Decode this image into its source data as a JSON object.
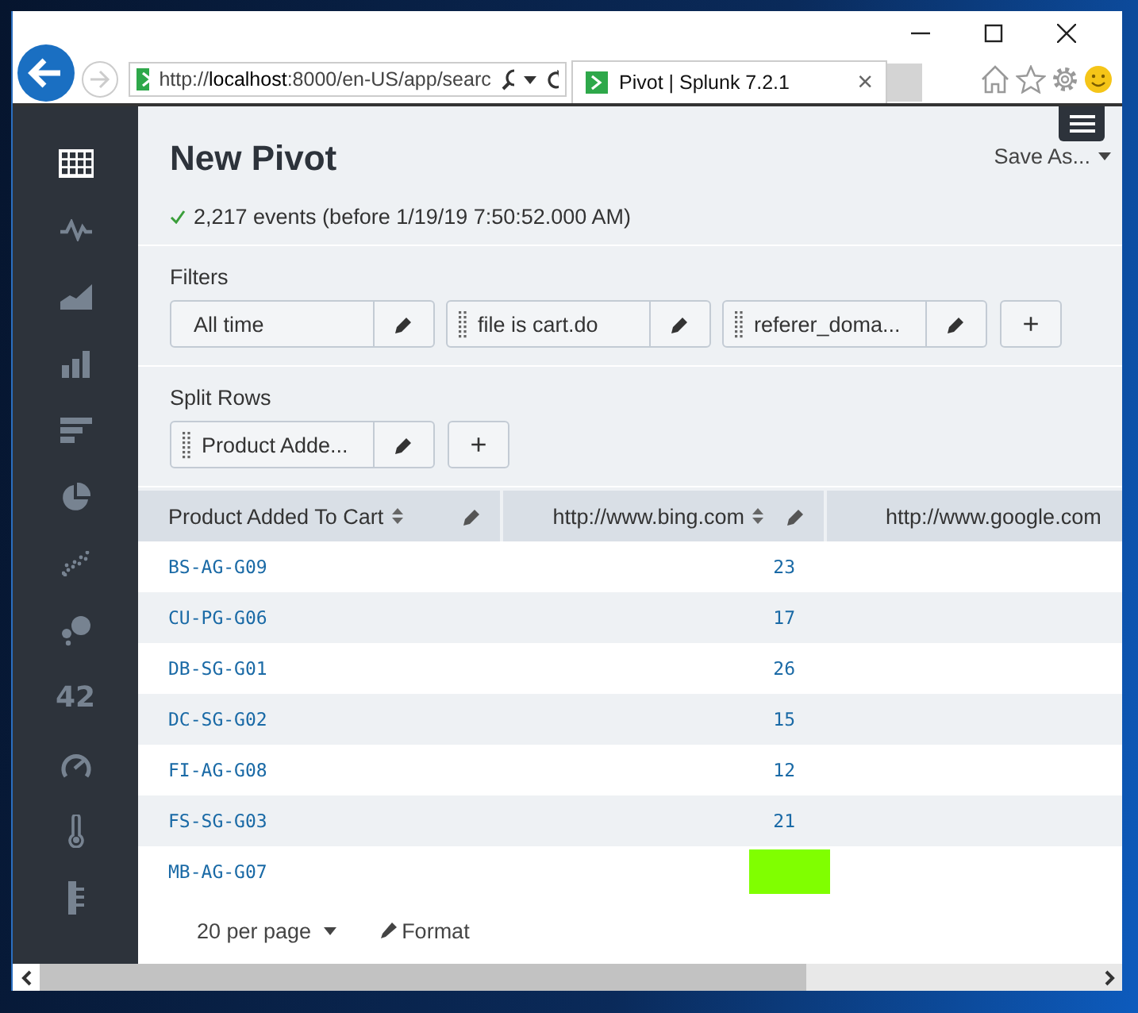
{
  "browser": {
    "address": "http://**localhost**:8000/en-US/app/searc",
    "tab": {
      "title": "Pivot | Splunk 7.2.1",
      "close": "×"
    }
  },
  "sidebar": {
    "items": [
      {
        "kind": "table",
        "selected": true
      },
      {
        "kind": "pulse",
        "selected": false
      },
      {
        "kind": "area",
        "selected": false
      },
      {
        "kind": "columns",
        "selected": false
      },
      {
        "kind": "bars",
        "selected": false
      },
      {
        "kind": "pie",
        "selected": false
      },
      {
        "kind": "scatter",
        "selected": false
      },
      {
        "kind": "bubble",
        "selected": false
      },
      {
        "kind": "number",
        "label": "42",
        "selected": false
      },
      {
        "kind": "gauge",
        "selected": false
      },
      {
        "kind": "thermometer",
        "selected": false
      },
      {
        "kind": "ruler",
        "selected": false
      }
    ]
  },
  "page": {
    "title": "New Pivot",
    "save_as": "Save As...",
    "status": "2,217 events (before 1/19/19 7:50:52.000 AM)"
  },
  "filters": {
    "label": "Filters",
    "items": [
      {
        "label": "All time",
        "draggable": false
      },
      {
        "label": "file is cart.do",
        "draggable": true
      },
      {
        "label": "referer_doma...",
        "draggable": true
      }
    ],
    "add": "+"
  },
  "split_rows": {
    "label": "Split Rows",
    "items": [
      {
        "label": "Product Adde...",
        "draggable": true
      }
    ],
    "add": "+"
  },
  "table": {
    "columns": [
      {
        "label": "Product Added To Cart",
        "editable": true
      },
      {
        "label": "http://www.bing.com",
        "editable": true
      },
      {
        "label": "http://www.google.com"
      }
    ],
    "rows": [
      {
        "cells": [
          "BS-AG-G09",
          "23"
        ]
      },
      {
        "cells": [
          "CU-PG-G06",
          "17"
        ]
      },
      {
        "cells": [
          "DB-SG-G01",
          "26"
        ]
      },
      {
        "cells": [
          "DC-SG-G02",
          "15"
        ]
      },
      {
        "cells": [
          "FI-AG-G08",
          "12"
        ]
      },
      {
        "cells": [
          "FS-SG-G03",
          "21"
        ]
      },
      {
        "cells": [
          "MB-AG-G07"
        ],
        "color": "#80ff00"
      }
    ]
  },
  "footer": {
    "per_page": "20 per page",
    "format": "Format"
  }
}
